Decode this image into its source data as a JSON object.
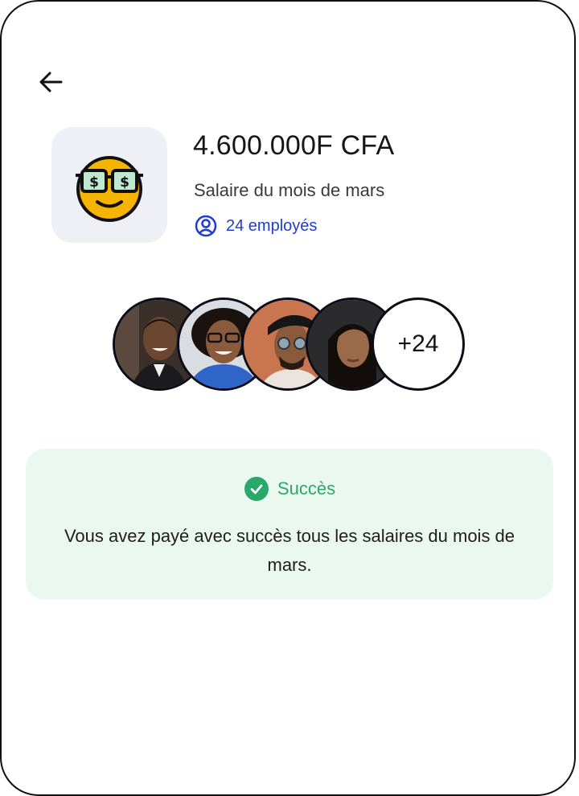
{
  "payment": {
    "amount": "4.600.000F CFA",
    "description": "Salaire du mois de mars",
    "employees_label": "24 employés",
    "icon": "money-eyes-smiley-icon"
  },
  "avatars": {
    "people": [
      {
        "name": "employee-avatar-1"
      },
      {
        "name": "employee-avatar-2"
      },
      {
        "name": "employee-avatar-3"
      },
      {
        "name": "employee-avatar-4"
      }
    ],
    "more_label": "+24"
  },
  "success": {
    "title": "Succès",
    "message": "Vous avez payé avec succès tous les salaires du mois de mars.",
    "color": "#2aa86a",
    "background": "#eaf8f0"
  },
  "colors": {
    "accent": "#1f3bd6",
    "tile_bg": "#eef0f5"
  }
}
